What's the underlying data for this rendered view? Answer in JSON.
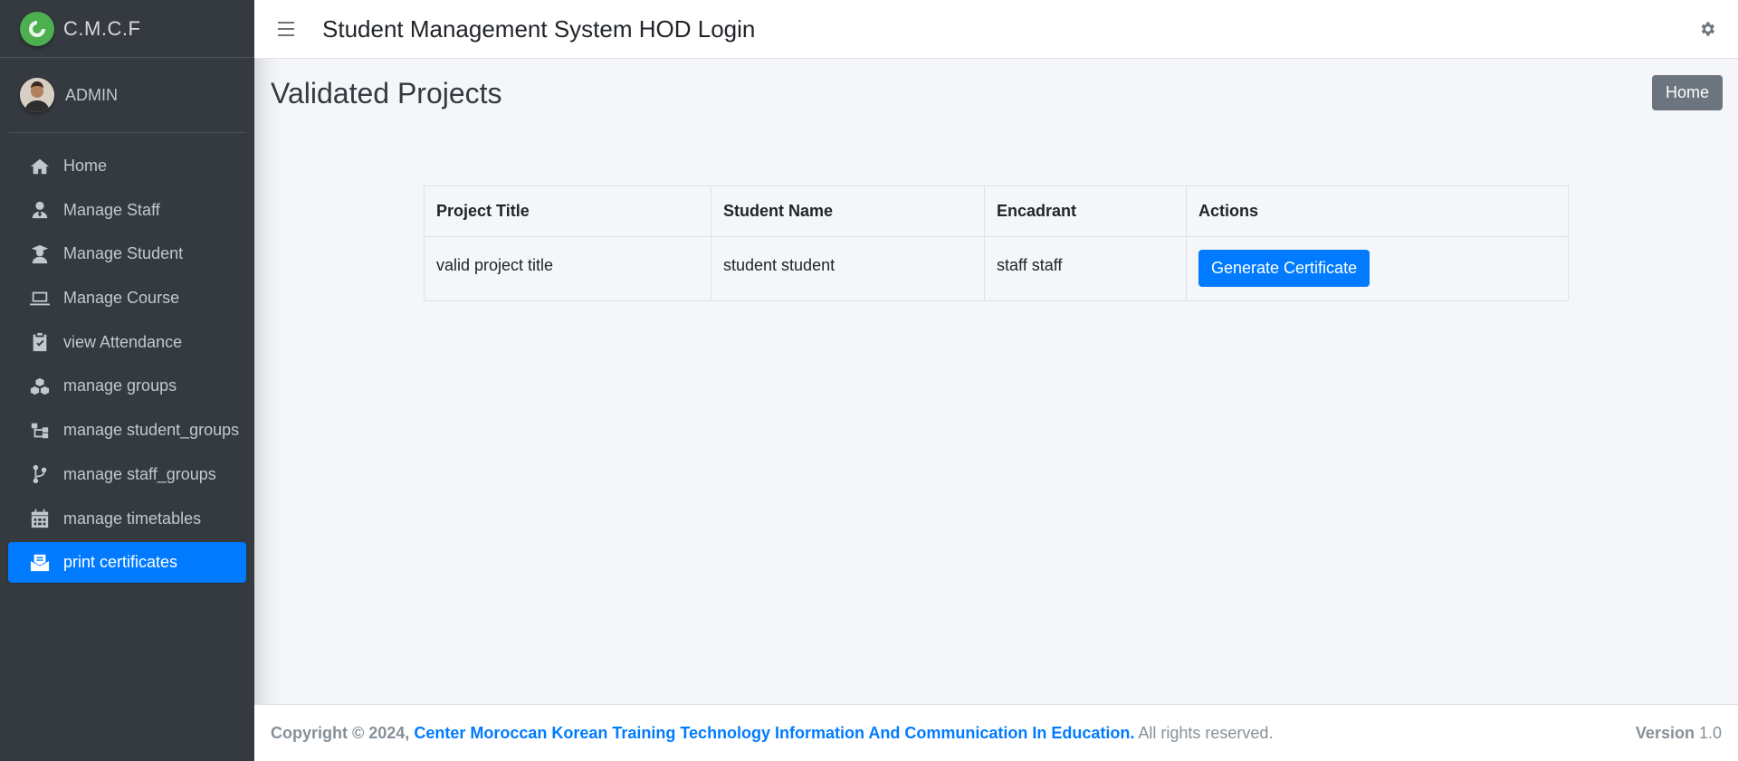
{
  "brand": {
    "name": "C.M.C.F"
  },
  "user": {
    "name": "ADMIN"
  },
  "sidebar": {
    "items": [
      {
        "label": "Home",
        "icon": "home-icon"
      },
      {
        "label": "Manage Staff",
        "icon": "user-tie-icon"
      },
      {
        "label": "Manage Student",
        "icon": "user-graduate-icon"
      },
      {
        "label": "Manage Course",
        "icon": "laptop-icon"
      },
      {
        "label": "view Attendance",
        "icon": "clipboard-check-icon"
      },
      {
        "label": "manage groups",
        "icon": "cubes-icon"
      },
      {
        "label": "manage student_groups",
        "icon": "sitemap-icon"
      },
      {
        "label": "manage staff_groups",
        "icon": "code-branch-icon"
      },
      {
        "label": "manage timetables",
        "icon": "calendar-icon"
      },
      {
        "label": "print certificates",
        "icon": "envelope-open-text-icon",
        "active": true
      }
    ]
  },
  "header": {
    "title": "Student Management System HOD Login"
  },
  "main": {
    "page_title": "Validated Projects",
    "home_button": "Home",
    "table": {
      "columns": [
        "Project Title",
        "Student Name",
        "Encadrant",
        "Actions"
      ],
      "rows": [
        {
          "project_title": "valid project title",
          "student_name": "student student",
          "encadrant": "staff staff",
          "action_label": "Generate Certificate"
        }
      ]
    }
  },
  "footer": {
    "copyright_prefix": "Copyright © 2024,",
    "org_name": "Center Moroccan Korean Training Technology Information And Communication In Education.",
    "rights": "All rights reserved.",
    "version_label": "Version",
    "version_value": "1.0"
  },
  "colors": {
    "sidebar_bg": "#343a40",
    "accent": "#007bff",
    "secondary": "#6c757d",
    "content_bg": "#f4f6f9"
  }
}
